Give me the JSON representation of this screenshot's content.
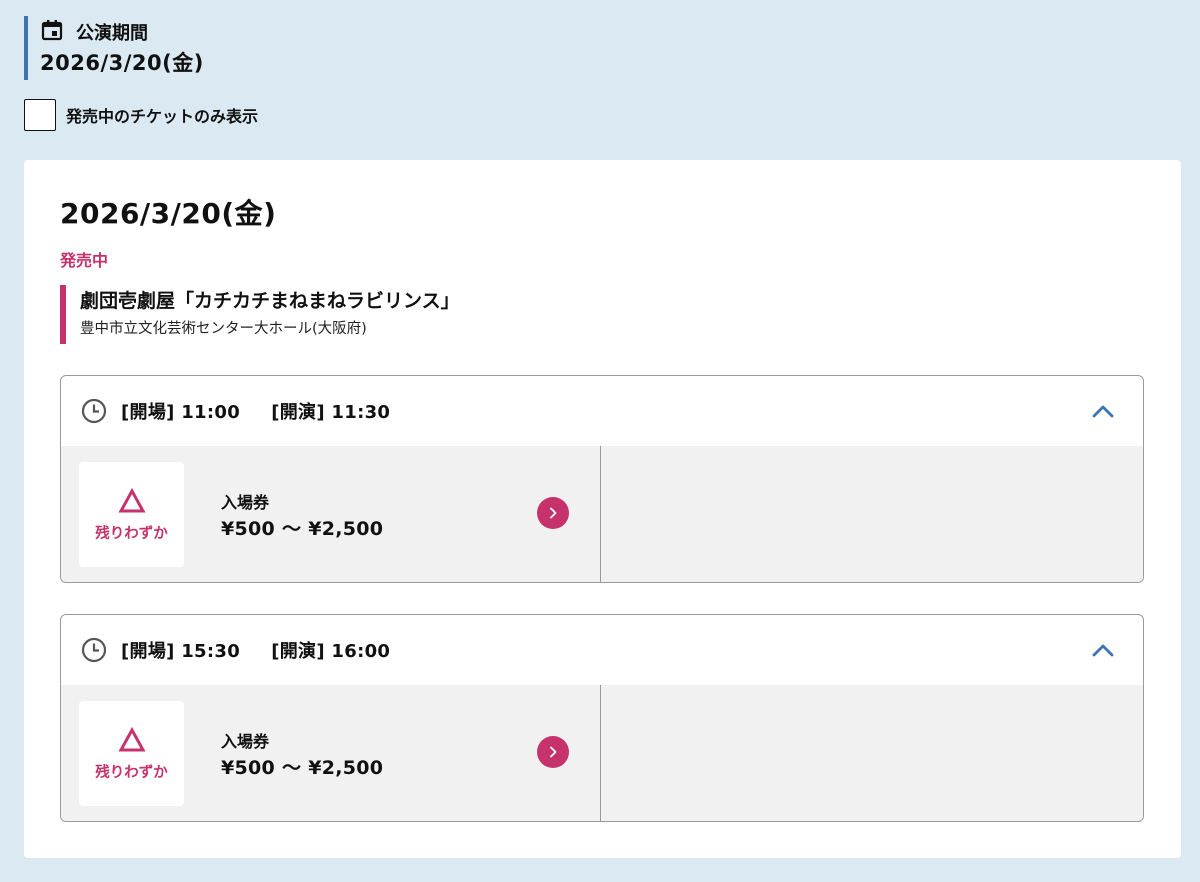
{
  "period": {
    "label": "公演期間",
    "date": "2026/3/20(金)",
    "icon": "calendar-icon"
  },
  "filter": {
    "label": "発売中のチケットのみ表示",
    "checked": false
  },
  "card": {
    "date": "2026/3/20(金)",
    "status": "発売中",
    "event_title": "劇団壱劇屋「カチカチまねまねラビリンス」",
    "venue": "豊中市立文化芸術センター大ホール(大阪府)"
  },
  "performances": [
    {
      "open_label": "[開場]",
      "open_time": "11:00",
      "start_label": "[開演]",
      "start_time": "11:30",
      "ticket": {
        "availability_symbol": "triangle-icon",
        "availability_label": "残りわずか",
        "name": "入場券",
        "price": "¥500 〜 ¥2,500"
      }
    },
    {
      "open_label": "[開場]",
      "open_time": "15:30",
      "start_label": "[開演]",
      "start_time": "16:00",
      "ticket": {
        "availability_symbol": "triangle-icon",
        "availability_label": "残りわずか",
        "name": "入場券",
        "price": "¥500 〜 ¥2,500"
      }
    }
  ],
  "colors": {
    "background": "#dbe9f3",
    "accent_blue": "#3d74b4",
    "accent_pink": "#c6326c",
    "panel_gray": "#f1f1f1"
  }
}
